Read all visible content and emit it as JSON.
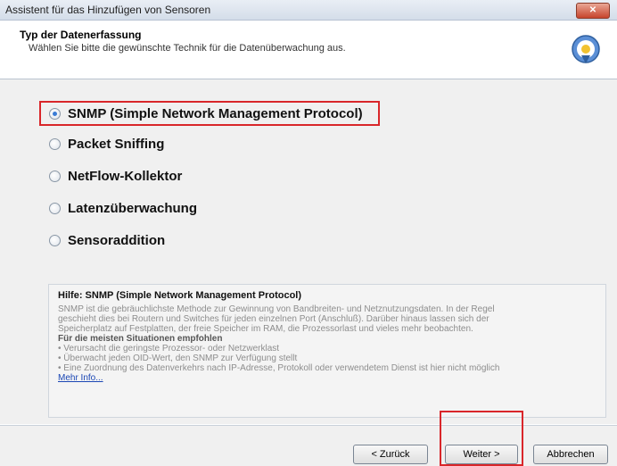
{
  "window": {
    "title": "Assistent für das Hinzufügen von Sensoren",
    "close_label": "✕"
  },
  "header": {
    "title": "Typ der Datenerfassung",
    "subtitle": "Wählen Sie bitte die gewünschte Technik für die Datenüberwachung aus.",
    "icon": "wizard-globe-icon"
  },
  "options": [
    {
      "label": "SNMP (Simple Network Management Protocol)",
      "checked": true
    },
    {
      "label": "Packet Sniffing",
      "checked": false
    },
    {
      "label": "NetFlow-Kollektor",
      "checked": false
    },
    {
      "label": "Latenzüberwachung",
      "checked": false
    },
    {
      "label": "Sensoraddition",
      "checked": false
    }
  ],
  "help": {
    "title": "Hilfe: SNMP (Simple Network Management Protocol)",
    "line1": "SNMP ist die gebräuchlichste Methode zur Gewinnung von Bandbreiten- und Netznutzungsdaten. In der Regel",
    "line2": "geschieht dies bei Routern und Switches für jeden einzelnen Port (Anschluß). Darüber hinaus lassen sich der",
    "line3": "Speicherplatz auf Festplatten, der freie Speicher im RAM, die Prozessorlast und vieles mehr beobachten.",
    "subheading": "Für die meisten Situationen empfohlen",
    "bullets": [
      "Verursacht die geringste Prozessor- oder Netzwerklast",
      "Überwacht jeden OID-Wert, den SNMP zur Verfügung stellt",
      "Eine Zuordnung des Datenverkehrs nach IP-Adresse, Protokoll oder verwendetem Dienst ist hier nicht möglich"
    ],
    "more_link": "Mehr Info..."
  },
  "footer": {
    "back_label": "< Zurück",
    "next_label": "Weiter >",
    "cancel_label": "Abbrechen"
  }
}
